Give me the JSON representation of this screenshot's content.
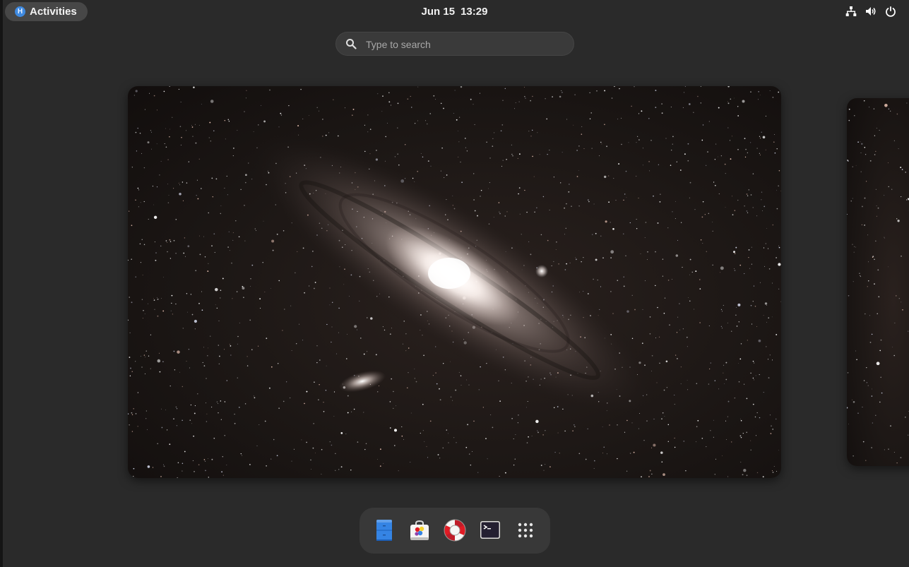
{
  "topbar": {
    "activities_label": "Activities",
    "os_logo_glyph": "H",
    "date": "Jun 15",
    "time": "13:29",
    "tray_icons": [
      "network-icon",
      "volume-icon",
      "power-icon"
    ]
  },
  "search": {
    "placeholder": "Type to search"
  },
  "workspaces": [
    {
      "name": "workspace-1",
      "wallpaper": "andromeda-galaxy"
    },
    {
      "name": "workspace-2",
      "wallpaper": "andromeda-galaxy"
    }
  ],
  "dash": {
    "apps": [
      {
        "name": "files-app",
        "icon": "file-cabinet-icon"
      },
      {
        "name": "software-app",
        "icon": "software-bag-icon"
      },
      {
        "name": "help-app",
        "icon": "lifebuoy-icon"
      },
      {
        "name": "terminal-app",
        "icon": "terminal-icon"
      },
      {
        "name": "show-apps",
        "icon": "app-grid-icon"
      }
    ]
  },
  "colors": {
    "background": "#2a2a2a",
    "panel_pill": "#474747",
    "dash_bg": "#383838",
    "accent_blue": "#3584e4"
  }
}
